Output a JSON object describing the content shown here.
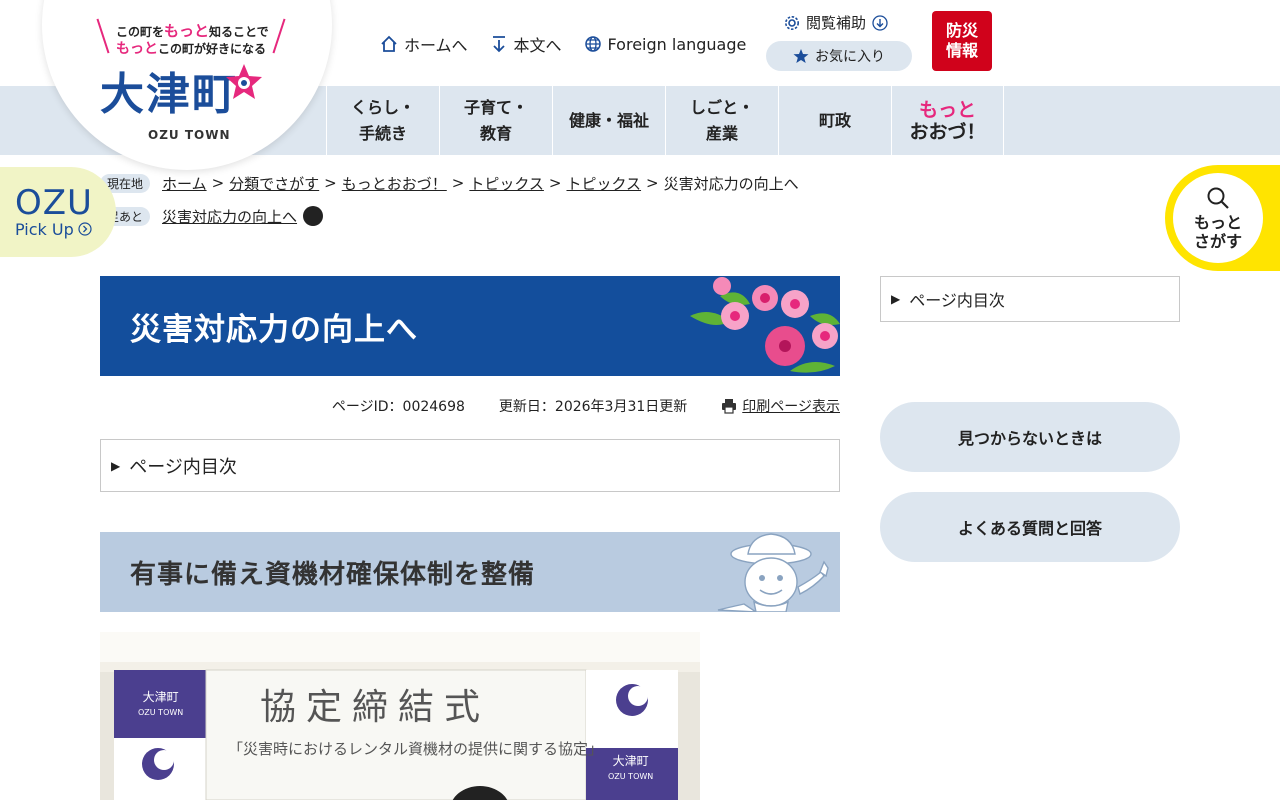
{
  "site": {
    "tagline_1a": "この町を",
    "tagline_1b": "もっと",
    "tagline_1c": "知ることで",
    "tagline_2a": "もっと",
    "tagline_2b": "この町が好きになる",
    "logo_name": "大津町",
    "logo_en": "OZU TOWN"
  },
  "top_links": [
    {
      "label": "ホームへ",
      "icon": "home-icon"
    },
    {
      "label": "本文へ",
      "icon": "arrow-down-icon"
    },
    {
      "label": "Foreign language",
      "icon": "globe-icon"
    }
  ],
  "assist": {
    "label": "閲覧補助"
  },
  "favorite": {
    "label": "お気に入り"
  },
  "disaster": {
    "line1": "防災",
    "line2": "情報",
    "color": "#d0021b"
  },
  "nav": [
    {
      "line1": "くらし・",
      "line2": "手続き"
    },
    {
      "line1": "子育て・",
      "line2": "教育"
    },
    {
      "line1": "健康・福祉",
      "line2": ""
    },
    {
      "line1": "しごと・",
      "line2": "産業"
    },
    {
      "line1": "町政",
      "line2": ""
    },
    {
      "line1": "もっと",
      "line2": "おおづ！"
    }
  ],
  "breadcrumb": {
    "label": "現在地",
    "items": [
      "ホーム",
      "分類でさがす",
      "もっとおおづ！",
      "トピックス",
      "トピックス"
    ],
    "current": "災害対応力の向上へ",
    "history_label": "足あと",
    "history_item": "災害対応力の向上へ"
  },
  "pickup": {
    "title": "OZU",
    "sub": "Pick Up"
  },
  "search": {
    "line1": "もっと",
    "line2": "さがす"
  },
  "page": {
    "title": "災害対応力の向上へ",
    "page_id": "ページID：0024698",
    "updated": "更新日：2026年3月31日更新",
    "print_label": "印刷ページ表示",
    "toc_label": "ページ内目次",
    "section_heading": "有事に備え資機材確保体制を整備"
  },
  "photo": {
    "banner_title": "協定締結式",
    "banner_sub": "「災害時におけるレンタル資機材の提供に関する協定」",
    "flag_text": "大津町",
    "flag_en": "OZU TOWN"
  },
  "sidebar": {
    "toc_label": "ページ内目次",
    "buttons": [
      "見つからないときは",
      "よくある質問と回答"
    ]
  },
  "colors": {
    "brand_blue": "#134e9c",
    "accent_pink": "#e6287d",
    "nav_bg": "#dde6ef",
    "search_yellow": "#ffe400",
    "pickup_bg": "#f1f4c6"
  }
}
